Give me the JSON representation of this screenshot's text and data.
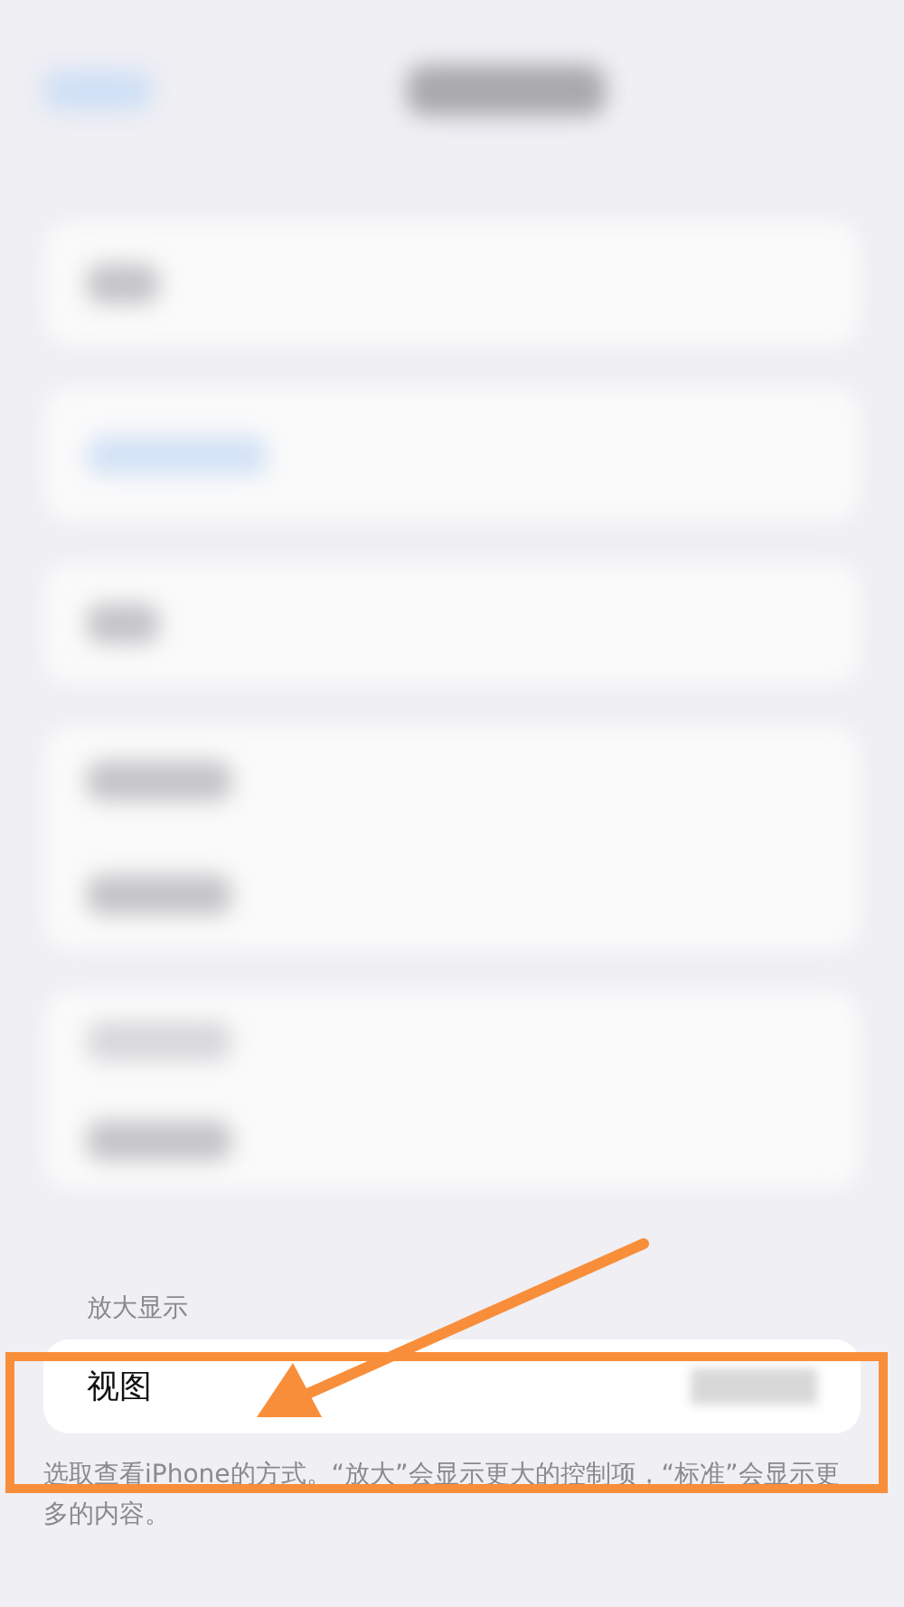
{
  "zoom_section": {
    "header": "放大显示",
    "row": {
      "label": "视图"
    },
    "footer": "选取查看iPhone的方式。“放大”会显示更大的控制项，“标准”会显示更多的内容。"
  },
  "annotation": {
    "highlight": true,
    "color": "#f98e3a"
  }
}
